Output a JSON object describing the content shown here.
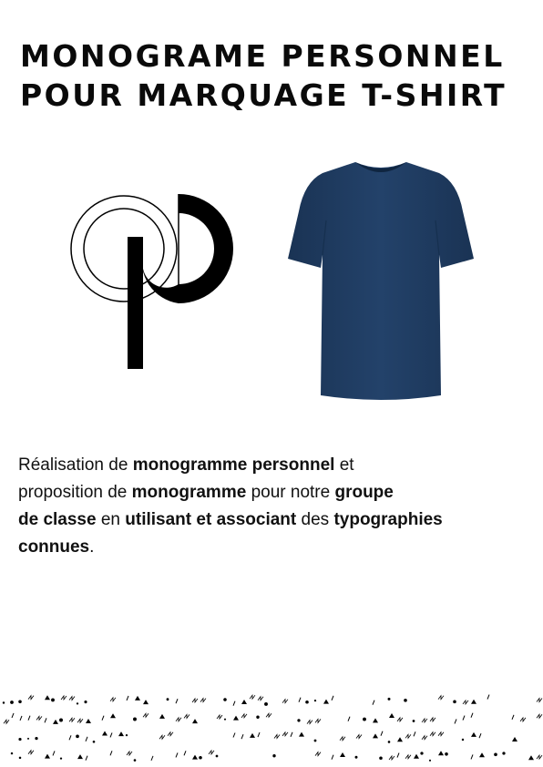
{
  "title": {
    "line1": "MONOGRAME PERSONNEL",
    "line2": "POUR MARQUAGE T-SHIRT"
  },
  "description": {
    "s1": "Réalisation de ",
    "b1": "monogramme personnel",
    "s2": " et",
    "s3": "proposition de ",
    "b2": "monogramme",
    "s4": " pour notre ",
    "b3": "groupe",
    "b4": "de classe",
    "s5": " en ",
    "b5": "utilisant et associant",
    "s6": " des ",
    "b6": "typographies",
    "b7": "connues",
    "s7": "."
  },
  "colors": {
    "tshirt": "#1e3a5c",
    "text": "#111111"
  }
}
